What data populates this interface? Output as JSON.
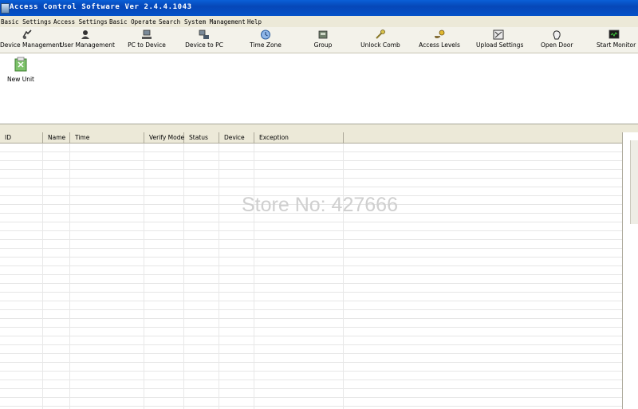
{
  "window": {
    "title": "Access Control Software  Ver 2.4.4.1043"
  },
  "menu": [
    "Basic Settings",
    "Access Settings",
    "Basic Operate",
    "Search",
    "System Management",
    "Help"
  ],
  "toolbar": [
    {
      "label": "Device Management",
      "icon": "device-management-icon"
    },
    {
      "label": "User Management",
      "icon": "user-management-icon"
    },
    {
      "label": "PC to Device",
      "icon": "pc-to-device-icon"
    },
    {
      "label": "Device to PC",
      "icon": "device-to-pc-icon"
    },
    {
      "label": "Time Zone",
      "icon": "clock-icon"
    },
    {
      "label": "Group",
      "icon": "group-icon"
    },
    {
      "label": "Unlock Comb",
      "icon": "unlock-comb-icon"
    },
    {
      "label": "Access Levels",
      "icon": "key-icon"
    },
    {
      "label": "Upload Settings",
      "icon": "upload-settings-icon"
    },
    {
      "label": "Open Door",
      "icon": "open-door-icon"
    },
    {
      "label": "Start Monitor",
      "icon": "monitor-icon"
    }
  ],
  "units": [
    {
      "label": "New Unit",
      "icon": "new-unit-icon"
    }
  ],
  "table": {
    "columns": [
      "ID",
      "Name",
      "Time",
      "Verify Mode",
      "Status",
      "Device",
      "Exception"
    ],
    "rows": []
  },
  "watermark": "Store No: 427666",
  "colors": {
    "titlebar": "#0452c8",
    "chrome": "#ece9d8"
  }
}
